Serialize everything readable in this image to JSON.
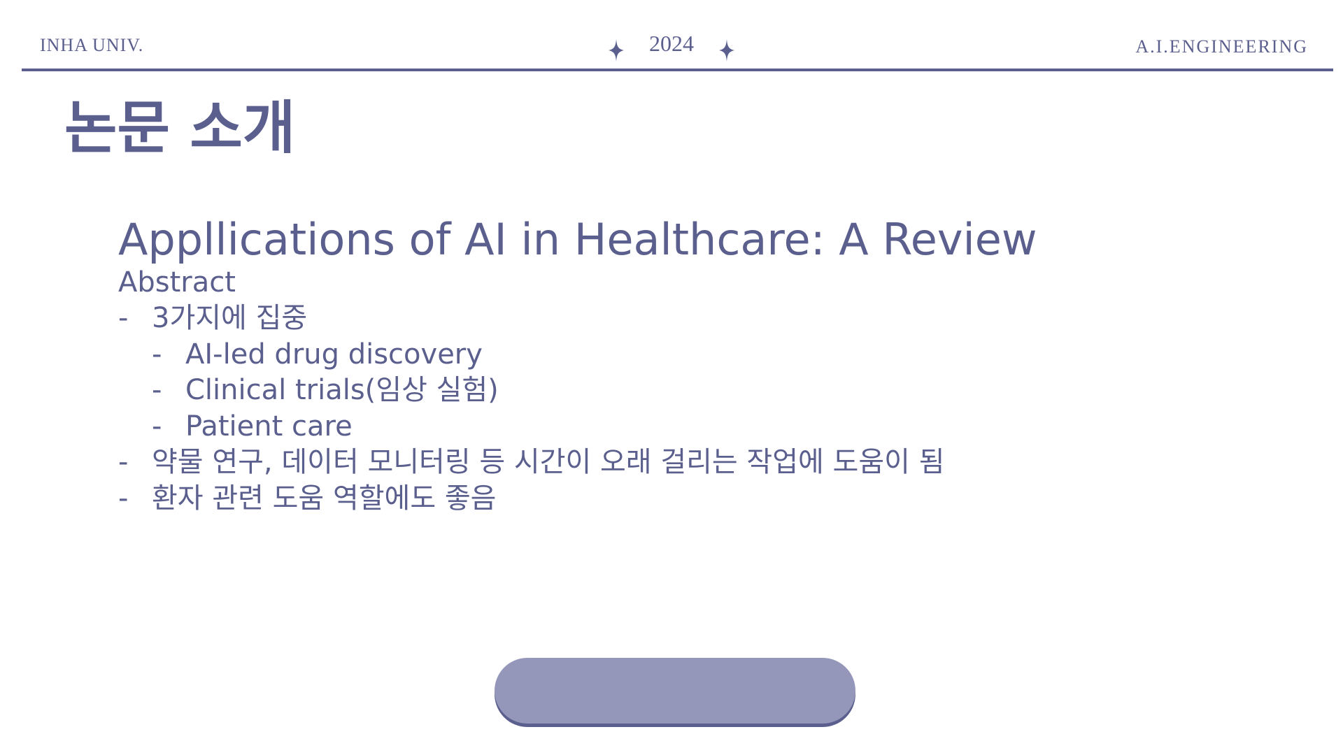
{
  "header": {
    "left": "INHA UNIV.",
    "center_year": "2024",
    "right": "A.I.ENGINEERING"
  },
  "slide": {
    "title": "논문 소개",
    "paper_title": "Appllications of AI in Healthcare: A Review",
    "abstract_label": "Abstract",
    "bullets": [
      {
        "level": 1,
        "text": "3가지에 집중"
      },
      {
        "level": 2,
        "text": "AI-led drug discovery"
      },
      {
        "level": 2,
        "text": "Clinical trials(임상 실험)"
      },
      {
        "level": 2,
        "text": "Patient care"
      },
      {
        "level": 1,
        "text": "약물 연구, 데이터 모니터링 등 시간이 오래 걸리는 작업에 도움이 됨"
      },
      {
        "level": 1,
        "text": "환자 관련 도움 역할에도 좋음"
      }
    ],
    "bullet_marker": "-"
  },
  "colors": {
    "primary": "#5b5f8e",
    "pill": "#9497b9",
    "background": "#ffffff"
  },
  "icons": [
    "sparkle-icon",
    "sparkle-icon"
  ]
}
